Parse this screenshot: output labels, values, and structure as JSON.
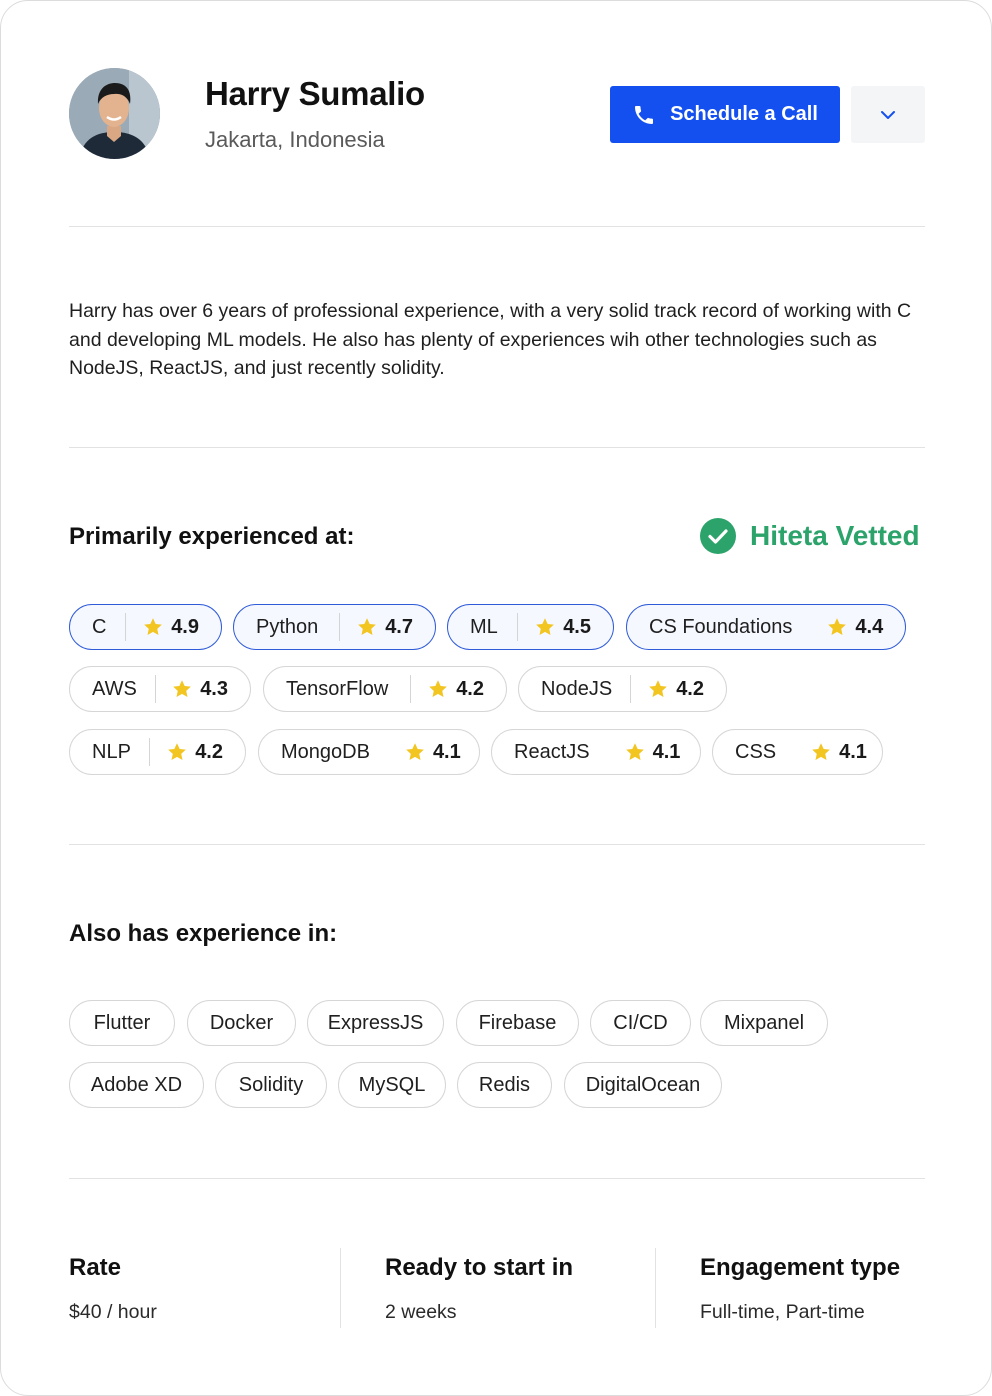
{
  "profile": {
    "name": "Harry Sumalio",
    "location": "Jakarta, Indonesia",
    "avatar_icon": "person-avatar"
  },
  "actions": {
    "schedule_label": "Schedule a Call",
    "schedule_icon": "phone-icon",
    "more_icon": "chevron-down-icon",
    "accent_color": "#1450f0"
  },
  "bio": "Harry has over 6 years of professional experience, with a very solid track record of working with C and developing ML models. He also has plenty of experiences wih other technologies such as NodeJS, ReactJS, and just recently solidity.",
  "primary": {
    "title": "Primarily experienced at:",
    "vetted_label": "Hiteta Vetted",
    "vetted_color": "#2ca36a",
    "skills": [
      {
        "name": "C",
        "rating": "4.9",
        "highlight": true
      },
      {
        "name": "Python",
        "rating": "4.7",
        "highlight": true
      },
      {
        "name": "ML",
        "rating": "4.5",
        "highlight": true
      },
      {
        "name": "CS Foundations",
        "rating": "4.4",
        "highlight": true
      },
      {
        "name": "AWS",
        "rating": "4.3",
        "highlight": false
      },
      {
        "name": "TensorFlow",
        "rating": "4.2",
        "highlight": false
      },
      {
        "name": "NodeJS",
        "rating": "4.2",
        "highlight": false
      },
      {
        "name": "NLP",
        "rating": "4.2",
        "highlight": false
      },
      {
        "name": "MongoDB",
        "rating": "4.1",
        "highlight": false
      },
      {
        "name": "ReactJS",
        "rating": "4.1",
        "highlight": false
      },
      {
        "name": "CSS",
        "rating": "4.1",
        "highlight": false
      }
    ]
  },
  "also": {
    "title": "Also has experience in:",
    "skills": [
      "Flutter",
      "Docker",
      "ExpressJS",
      "Firebase",
      "CI/CD",
      "Mixpanel",
      "Adobe XD",
      "Solidity",
      "MySQL",
      "Redis",
      "DigitalOcean"
    ]
  },
  "details": {
    "rate": {
      "title": "Rate",
      "value": "$40 / hour"
    },
    "start": {
      "title": "Ready to start in",
      "value": "2 weeks"
    },
    "engagement": {
      "title": "Engagement type",
      "value": "Full-time, Part-time"
    }
  }
}
